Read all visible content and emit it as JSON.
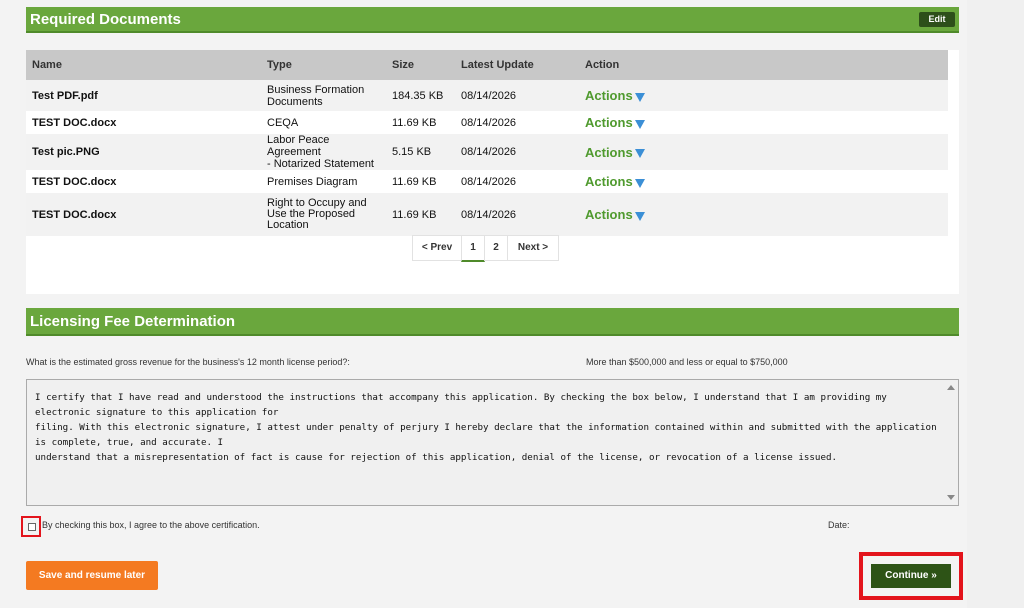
{
  "docs_section": {
    "title": "Required Documents",
    "edit_label": "Edit",
    "columns": [
      "Name",
      "Type",
      "Size",
      "Latest Update",
      "Action"
    ],
    "rows": [
      {
        "name": "Test PDF.pdf",
        "type_lines": [
          "Business Formation",
          "Documents"
        ],
        "size": "184.35 KB",
        "date": "08/14/2026",
        "action": "Actions"
      },
      {
        "name": "TEST DOC.docx",
        "type_lines": [
          "CEQA"
        ],
        "size": "11.69 KB",
        "date": "08/14/2026",
        "action": "Actions"
      },
      {
        "name": "Test pic.PNG",
        "type_lines": [
          "Labor Peace Agreement",
          "- Notarized Statement"
        ],
        "size": "5.15 KB",
        "date": "08/14/2026",
        "action": "Actions"
      },
      {
        "name": "TEST DOC.docx",
        "type_lines": [
          "Premises Diagram"
        ],
        "size": "11.69 KB",
        "date": "08/14/2026",
        "action": "Actions"
      },
      {
        "name": "TEST DOC.docx",
        "type_lines": [
          "Right to Occupy and",
          "Use the Proposed",
          "Location"
        ],
        "size": "11.69 KB",
        "date": "08/14/2026",
        "action": "Actions"
      }
    ],
    "pager": {
      "prev": "< Prev",
      "page1": "1",
      "page2": "2",
      "next": "Next >"
    }
  },
  "fee_section": {
    "title": "Licensing Fee Determination",
    "question": "What is the estimated gross revenue for the business's 12 month license period?:",
    "answer": "More than $500,000 and less or equal to $750,000"
  },
  "certification": {
    "lines": [
      "I certify that I have read and understood the instructions that accompany this application. By checking the box below, I understand that I am providing my electronic signature to this application for",
      "filing. With this electronic signature, I attest under penalty of perjury I hereby declare that the information contained within and submitted with the application is complete, true, and accurate. I",
      "understand that a misrepresentation of fact is cause for rejection of this application, denial of the license, or revocation of a license issued."
    ],
    "checkbox_label": "By checking this box, I agree to the above certification.",
    "date_label": "Date:"
  },
  "buttons": {
    "save": "Save and resume later",
    "continue": "Continue »"
  },
  "colors": {
    "header_green": "#6aa73d",
    "link_green": "#4f9a2e",
    "save_orange": "#f47a21",
    "continue_dark_green": "#2d5316",
    "highlight_red": "#e3141c",
    "dropdown_blue": "#3b8fd6"
  },
  "icons": {
    "actions_dropdown": "triangle-down-icon",
    "scroll_up": "scroll-up-arrow-icon",
    "scroll_down": "scroll-down-arrow-icon"
  }
}
